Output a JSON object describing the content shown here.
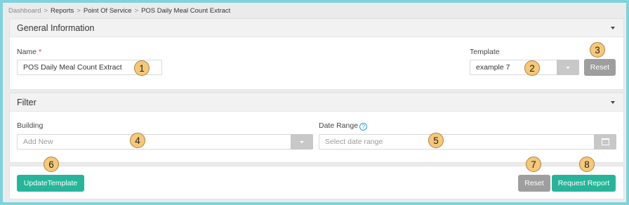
{
  "breadcrumb": {
    "items": [
      "Dashboard",
      "Reports",
      "Point Of Service",
      "POS Daily Meal Count Extract"
    ],
    "separator": ">"
  },
  "general": {
    "title": "General Information",
    "name_label": "Name",
    "name_required": "*",
    "name_value": "POS Daily Meal Count Extract",
    "template_label": "Template",
    "template_value": "example 7",
    "reset_label": "Reset"
  },
  "filter": {
    "title": "Filter",
    "building_label": "Building",
    "building_placeholder": "Add New",
    "date_label": "Date Range",
    "help_glyph": "?",
    "date_placeholder": "Select date range"
  },
  "footer": {
    "update_label": "UpdateTemplate",
    "reset_label": "Reset",
    "request_label": "Request Report"
  },
  "markers": [
    "1",
    "2",
    "3",
    "4",
    "5",
    "6",
    "7",
    "8"
  ],
  "colors": {
    "teal": "#26b59a",
    "gray_button": "#9e9e9e",
    "marker": "#f6c877",
    "frame": "#7fd3dc"
  }
}
